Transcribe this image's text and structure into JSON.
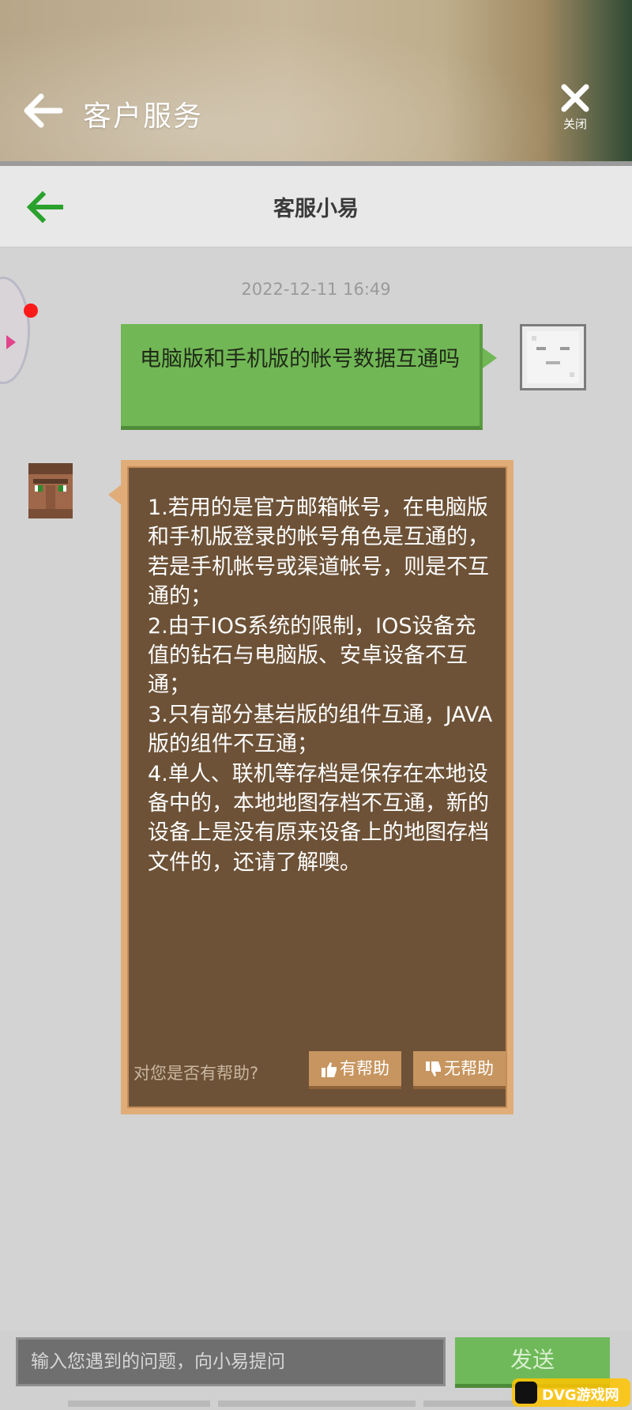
{
  "outer_header": {
    "title": "客户服务",
    "close_label": "关闭"
  },
  "inner_header": {
    "title": "客服小易"
  },
  "chat": {
    "timestamp": "2022-12-11 16:49",
    "user_message": "电脑版和手机版的帐号数据互通吗",
    "bot_lines": [
      "1.若用的是官方邮箱帐号，在电脑版和手机版登录的帐号角色是互通的，若是手机帐号或渠道帐号，则是不互通的；",
      "2.由于IOS系统的限制，IOS设备充值的钻石与电脑版、安卓设备不互通；",
      "3.只有部分基岩版的组件互通，JAVA版的组件不互通；",
      "4.单人、联机等存档是保存在本地设备中的，本地地图存档不互通，新的设备上是没有原来设备上的地图存档文件的，还请了解噢。"
    ],
    "feedback": {
      "question": "对您是否有帮助?",
      "helpful": "有帮助",
      "not_helpful": "无帮助"
    }
  },
  "input_bar": {
    "placeholder": "输入您遇到的问题，向小易提问",
    "send_label": "发送"
  },
  "watermark": {
    "text": "DVG游戏网"
  },
  "colors": {
    "user_bubble": "#71b755",
    "bot_bubble": "#6d5237",
    "bot_border": "#e0ac78",
    "accent_green": "#2aa12c"
  },
  "icons": [
    "back-arrow-icon",
    "close-icon",
    "thumbs-up-icon",
    "thumbs-down-icon"
  ]
}
